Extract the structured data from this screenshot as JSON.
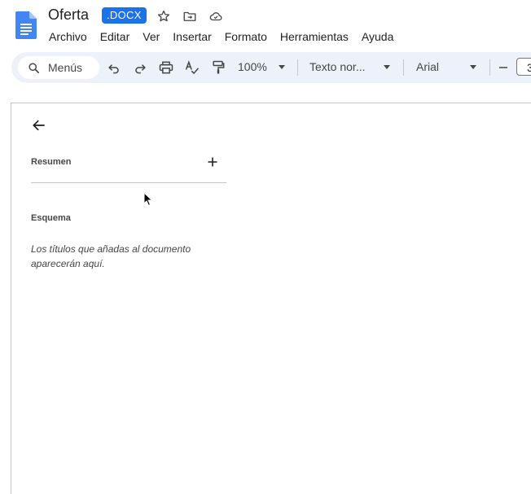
{
  "app": {
    "doc_title": "Oferta",
    "file_badge": ".DOCX",
    "title_icons": [
      "star-icon",
      "move-to-folder-icon",
      "cloud-saved-icon"
    ]
  },
  "menu": [
    "Archivo",
    "Editar",
    "Ver",
    "Insertar",
    "Formato",
    "Herramientas",
    "Ayuda"
  ],
  "toolbar": {
    "search_label": "Menús",
    "zoom": "100%",
    "paragraph_style": "Texto nor...",
    "font": "Arial",
    "font_size": "3",
    "icons": [
      "undo-icon",
      "redo-icon",
      "print-icon",
      "spellcheck-icon",
      "paint-format-icon",
      "decrease-font-size-icon"
    ]
  },
  "outline_panel": {
    "summary_title": "Resumen",
    "outline_title": "Esquema",
    "empty_text": "Los títulos que añadas al documento aparecerán aquí."
  },
  "colors": {
    "accent": "#1a73e8",
    "toolbar_bg": "#edf2fa"
  }
}
